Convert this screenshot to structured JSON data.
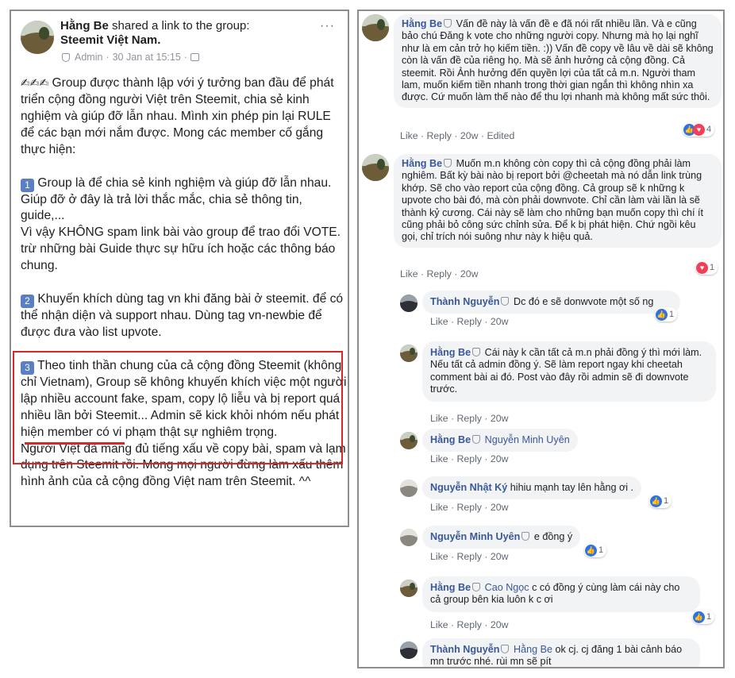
{
  "post": {
    "author": "Hằng Be",
    "action": "shared a link to the group:",
    "group": "Steemit Việt Nam",
    "role": "Admin",
    "timestamp": "30 Jan at 15:15",
    "more": "···",
    "intro": "Group được thành lập với ý tưởng ban đầu để phát triển cộng đồng người Việt trên Steemit, chia sẻ kinh nghiệm và giúp đỡ lẫn nhau. Mình xin phép pin lại RULE để các bạn mới nắm được. Mong các member cố gắng thực hiện:",
    "rule1_num": "1",
    "rule1": "Group là để chia sẻ kinh nghiệm và giúp đỡ lẫn nhau. Giúp đỡ ở đây là trả lời thắc mắc, chia sẻ thông tin, guide,...\nVì vậy KHÔNG spam link bài vào group để trao đổi VOTE. trừ những bài Guide thực sự hữu ích hoặc các thông báo chung.",
    "rule2_num": "2",
    "rule2": "Khuyến khích dùng tag vn khi đăng bài ở steemit. để có thể nhận diện và support nhau. Dùng tag vn-newbie để được đưa vào list upvote.",
    "rule3_num": "3",
    "rule3": "Theo tinh thần chung của cả cộng đồng Steemit (không chỉ Vietnam), Group sẽ không khuyến khích việc một người lập nhiều account fake, spam, copy lộ liễu và bị report quá nhiều lần bởi Steemit... Admin sẽ kick khỏi nhóm nếu phát hiện member có vi phạm thật sự nghiêm trọng.",
    "outro": "Người Việt đã mang đủ tiếng xấu về copy bài, spam và lạm dụng trên Steemit rồi. Mong mọi người đừng làm xấu thêm hình ảnh của cả cộng đồng Việt nam trên Steemit. ^^"
  },
  "comments": [
    {
      "author": "Hằng Be",
      "text": "Vấn đề này là vấn đề e đã nói rất nhiều lần. Và e cũng bảo chú Đăng k vote cho những người copy. Nhưng mà họ lại nghĩ như là em cản trở họ kiếm tiền. :)) Vấn đề copy về lâu về dài sẽ không còn là vấn đề của riêng họ. Mà sẽ ảnh hưởng cả cộng đồng. Cả steemit. Rồi Ảnh hưởng đến quyền lợi của tất cả m.n. Người tham lam, muốn kiếm tiền nhanh trong thời gian ngắn thì không nhìn xa được. Cứ muốn làm thế nào để thu lợi nhanh mà không mất sức thôi.",
      "like": "Like",
      "reply": "Reply",
      "time": "20w",
      "edited": "Edited",
      "reaction_count": "4"
    },
    {
      "author": "Hằng Be",
      "text": "Muốn m.n không còn copy thì cả cộng đồng phải làm nghiêm. Bất kỳ bài nào bị report bởi @cheetah mà nó dẫn link trùng khớp. Sẽ cho vào report của cộng đồng. Cả group sẽ k những k upvote cho bài đó, mà còn phải downvote. Chỉ cần làm vài lần là sẽ thành kỷ cương. Cái này sẽ làm cho những bạn muốn copy thì chí ít cũng phải bỏ công sức chỉnh sửa. Để k bị phát hiện. Chứ ngồi kêu gọi, chỉ trích nói suông như này k hiệu quả.",
      "like": "Like",
      "reply": "Reply",
      "time": "20w",
      "reaction_count": "1"
    },
    {
      "author": "Thành Nguyễn",
      "text": "Dc đó e sẽ donwvote một số ng",
      "like": "Like",
      "reply": "Reply",
      "time": "20w",
      "reaction_count": "1"
    },
    {
      "author": "Hằng Be",
      "text": "Cái này k cần tất cả m.n phải đồng ý thì mới làm. Nếu tất cả admin đồng ý. Sẽ làm report ngay khi cheetah comment bài ai đó. Post vào đây rồi admin sẽ đi downvote trước.",
      "like": "Like",
      "reply": "Reply",
      "time": "20w"
    },
    {
      "author": "Hằng Be",
      "mention": "Nguyễn Minh Uyên",
      "like": "Like",
      "reply": "Reply",
      "time": "20w"
    },
    {
      "author": "Nguyễn Nhật Ký",
      "text": "hihiu mạnh tay lên hằng ơi .",
      "like": "Like",
      "reply": "Reply",
      "time": "20w",
      "reaction_count": "1"
    },
    {
      "author": "Nguyễn Minh Uyên",
      "text": "e đồng ý",
      "like": "Like",
      "reply": "Reply",
      "time": "20w",
      "reaction_count": "1"
    },
    {
      "author": "Hằng Be",
      "mention": "Cao Ngọc",
      "text": "c có đồng ý cùng làm cái này cho cả group bên kia luôn k c ơi",
      "like": "Like",
      "reply": "Reply",
      "time": "20w",
      "reaction_count": "1"
    },
    {
      "author": "Thành Nguyễn",
      "mention": "Hằng Be",
      "text": "ok cj. cj đăng 1 bài cảnh báo mn trước nhé. rùi mn sẽ pít"
    }
  ],
  "separator": "·",
  "colors": {
    "link": "#385898",
    "bubble": "#f2f3f5",
    "highlight": "#d6272b",
    "badge": "#5b7fc4"
  }
}
